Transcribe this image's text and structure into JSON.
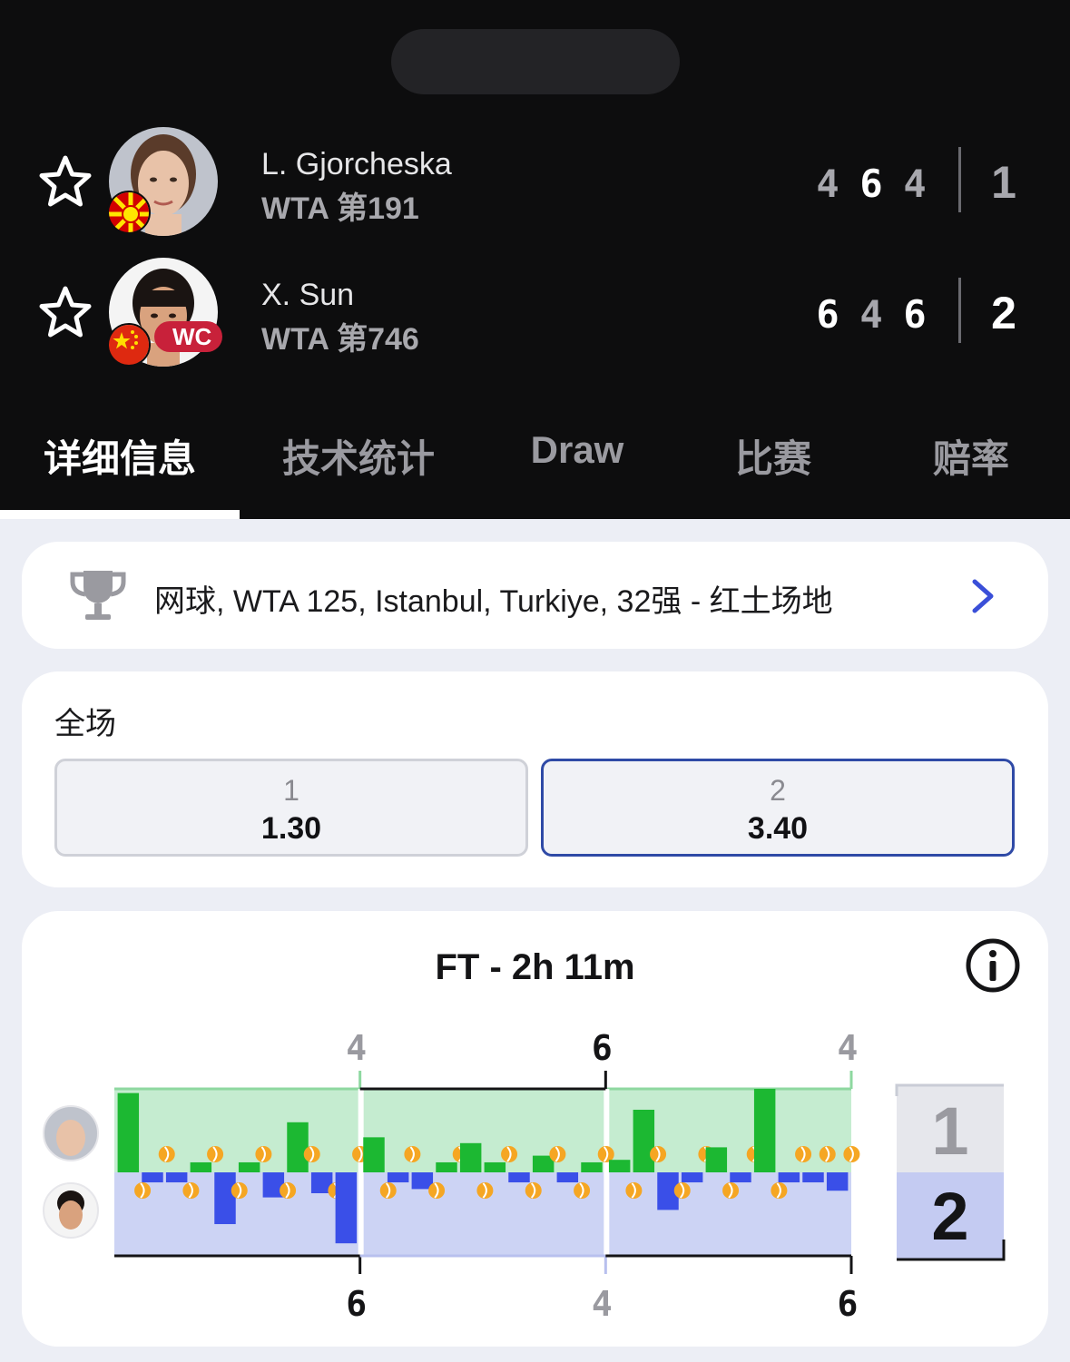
{
  "players": [
    {
      "name": "L. Gjorcheska",
      "rank": "WTA 第191",
      "sets": [
        "4",
        "6",
        "4"
      ],
      "sets_won": [
        false,
        true,
        false
      ],
      "total": "1",
      "flag": "north-macedonia-flag",
      "badge": ""
    },
    {
      "name": "X. Sun",
      "rank": "WTA 第746",
      "sets": [
        "6",
        "4",
        "6"
      ],
      "sets_won": [
        true,
        false,
        true
      ],
      "total": "2",
      "flag": "china-flag",
      "badge": "WC"
    }
  ],
  "tabs": [
    {
      "label": "详细信息",
      "active": true
    },
    {
      "label": "技术统计",
      "active": false
    },
    {
      "label": "Draw",
      "active": false
    },
    {
      "label": "比赛",
      "active": false
    },
    {
      "label": "赔率",
      "active": false
    }
  ],
  "tournament": {
    "text": "网球, WTA 125, Istanbul, Turkiye, 32强 - 红土场地",
    "icon": "trophy-icon"
  },
  "odds": {
    "title": "全场",
    "options": [
      {
        "label": "1",
        "value": "1.30",
        "selected": false
      },
      {
        "label": "2",
        "value": "3.40",
        "selected": true
      }
    ]
  },
  "momentum": {
    "status": "FT - 2h 11m",
    "set_labels_top": [
      "4",
      "6",
      "4"
    ],
    "set_labels_bottom": [
      "6",
      "4",
      "6"
    ],
    "summary": [
      "1",
      "2"
    ],
    "colors": {
      "p1": "#1cb832",
      "p2": "#3a4fe8",
      "p1_bg": "#c5ecd0",
      "p2_bg": "#ccd3f4",
      "ball": "#f5a623"
    }
  },
  "chart_data": {
    "type": "bar",
    "title": "FT - 2h 11m",
    "sets": [
      {
        "games": [
          {
            "v": 0.95,
            "serve": 2
          },
          {
            "v": -0.12,
            "serve": 1
          },
          {
            "v": -0.12,
            "serve": 2
          },
          {
            "v": 0.12,
            "serve": 1
          },
          {
            "v": -0.62,
            "serve": 2
          },
          {
            "v": 0.12,
            "serve": 1
          },
          {
            "v": -0.3,
            "serve": 2
          },
          {
            "v": 0.6,
            "serve": 1
          },
          {
            "v": -0.25,
            "serve": 2
          },
          {
            "v": -0.85,
            "serve": 1
          }
        ]
      },
      {
        "games": [
          {
            "v": 0.42,
            "serve": 2
          },
          {
            "v": -0.12,
            "serve": 1
          },
          {
            "v": -0.2,
            "serve": 2
          },
          {
            "v": 0.12,
            "serve": 1
          },
          {
            "v": 0.35,
            "serve": 2
          },
          {
            "v": 0.12,
            "serve": 1
          },
          {
            "v": -0.12,
            "serve": 2
          },
          {
            "v": 0.2,
            "serve": 1
          },
          {
            "v": -0.12,
            "serve": 2
          },
          {
            "v": 0.12,
            "serve": 1
          }
        ]
      },
      {
        "games": [
          {
            "v": 0.15,
            "serve": 2
          },
          {
            "v": 0.75,
            "serve": 1
          },
          {
            "v": -0.45,
            "serve": 2
          },
          {
            "v": -0.12,
            "serve": 1
          },
          {
            "v": 0.3,
            "serve": 2
          },
          {
            "v": -0.12,
            "serve": 1
          },
          {
            "v": 1.0,
            "serve": 2
          },
          {
            "v": -0.12,
            "serve": 1
          },
          {
            "v": -0.12,
            "serve": 1
          },
          {
            "v": -0.22,
            "serve": 1
          }
        ]
      }
    ]
  }
}
